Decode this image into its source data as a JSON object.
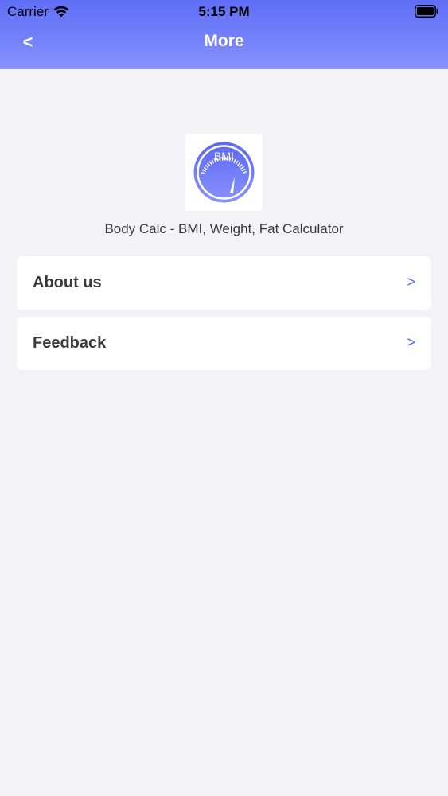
{
  "status_bar": {
    "carrier": "Carrier",
    "time": "5:15 PM",
    "wifi_icon": "wifi-icon",
    "battery_icon": "battery-icon"
  },
  "nav": {
    "back_label": "<",
    "title": "More"
  },
  "app": {
    "logo_text": "BMI",
    "name": "Body Calc - BMI, Weight, Fat Calculator"
  },
  "menu": {
    "items": [
      {
        "label": "About us",
        "chevron": ">"
      },
      {
        "label": "Feedback",
        "chevron": ">"
      }
    ]
  },
  "colors": {
    "header_gradient_top": "#5f6ef6",
    "header_gradient_bottom": "#8891fd",
    "background": "#f3f2f7",
    "chevron": "#5565e6",
    "text": "#3a3a3c"
  }
}
